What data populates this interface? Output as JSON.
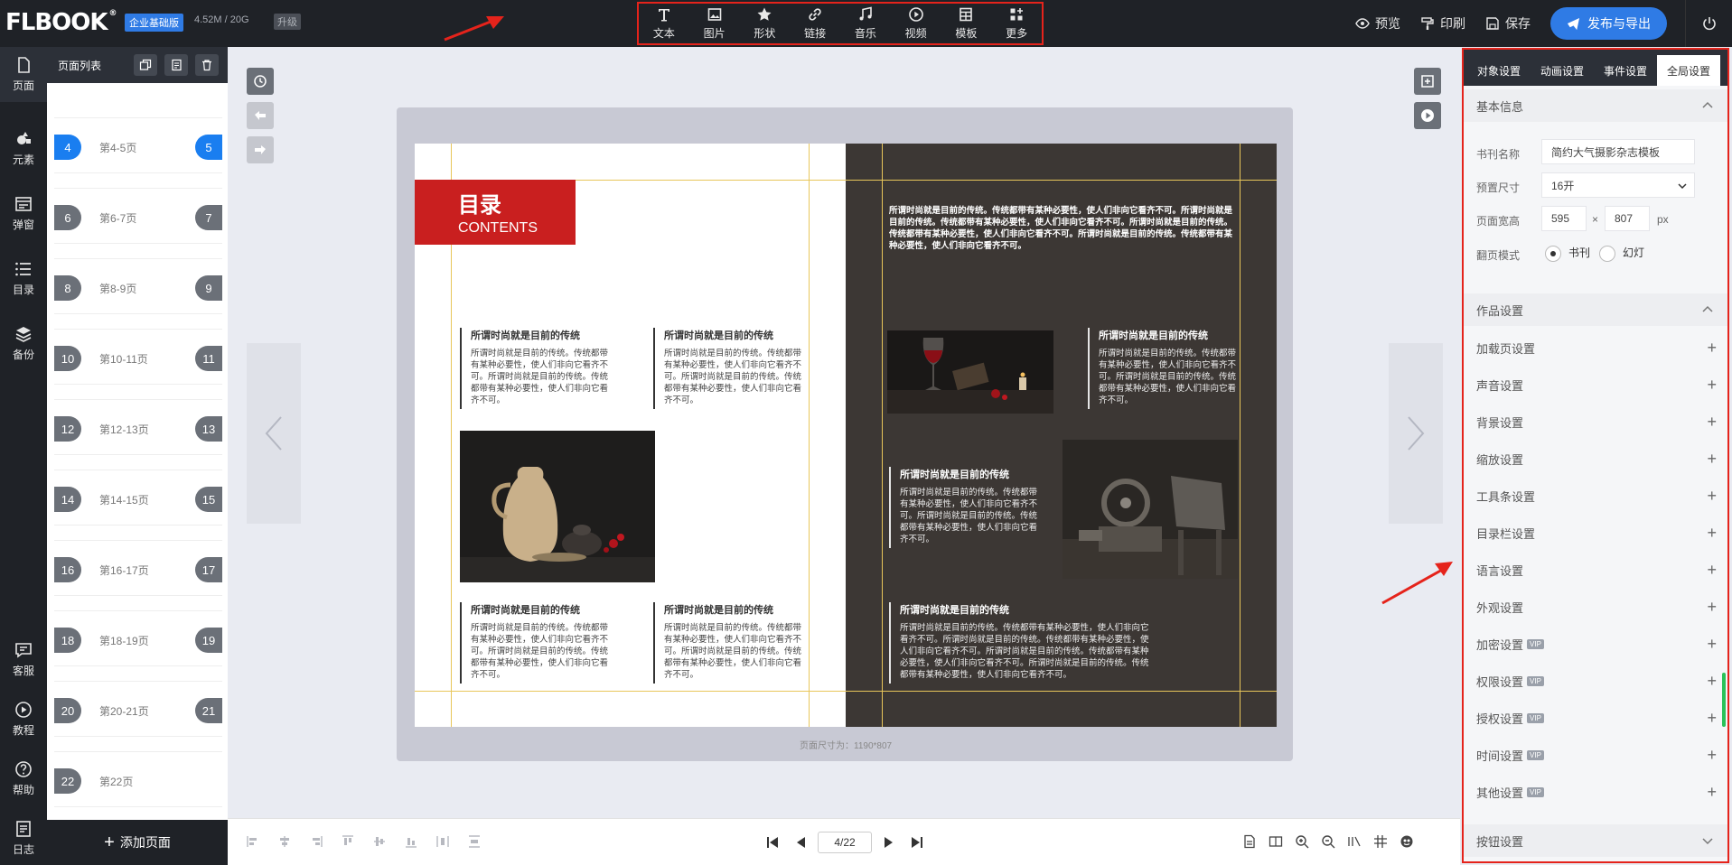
{
  "header": {
    "logo": "FLBOOK",
    "plan_badge": "企业基础版",
    "storage": "4.52M / 20G",
    "upgrade": "升级",
    "tools": [
      {
        "label": "文本",
        "icon": "text-icon"
      },
      {
        "label": "图片",
        "icon": "image-icon"
      },
      {
        "label": "形状",
        "icon": "star-icon"
      },
      {
        "label": "链接",
        "icon": "link-icon"
      },
      {
        "label": "音乐",
        "icon": "music-icon"
      },
      {
        "label": "视频",
        "icon": "video-icon"
      },
      {
        "label": "模板",
        "icon": "template-icon"
      },
      {
        "label": "更多",
        "icon": "more-icon"
      }
    ],
    "preview": "预览",
    "print": "印刷",
    "save": "保存",
    "publish": "发布与导出"
  },
  "sidebar": {
    "items": [
      {
        "label": "页面",
        "icon": "page-icon"
      },
      {
        "label": "元素",
        "icon": "elements-icon"
      },
      {
        "label": "弹窗",
        "icon": "popup-icon"
      },
      {
        "label": "目录",
        "icon": "list-icon"
      },
      {
        "label": "备份",
        "icon": "backup-icon"
      },
      {
        "label": "客服",
        "icon": "chat-icon"
      },
      {
        "label": "教程",
        "icon": "play-icon"
      },
      {
        "label": "帮助",
        "icon": "help-icon"
      },
      {
        "label": "日志",
        "icon": "log-icon"
      }
    ]
  },
  "pages_panel": {
    "title": "页面列表",
    "rows": [
      {
        "left": "4",
        "right": "5",
        "label": "第4-5页",
        "active": true
      },
      {
        "left": "6",
        "right": "7",
        "label": "第6-7页"
      },
      {
        "left": "8",
        "right": "9",
        "label": "第8-9页"
      },
      {
        "left": "10",
        "right": "11",
        "label": "第10-11页"
      },
      {
        "left": "12",
        "right": "13",
        "label": "第12-13页"
      },
      {
        "left": "14",
        "right": "15",
        "label": "第14-15页"
      },
      {
        "left": "16",
        "right": "17",
        "label": "第16-17页"
      },
      {
        "left": "18",
        "right": "19",
        "label": "第18-19页"
      },
      {
        "left": "20",
        "right": "21",
        "label": "第20-21页"
      },
      {
        "left": "22",
        "right": "",
        "label": "第22页"
      }
    ],
    "add_page": "添加页面"
  },
  "book": {
    "toc_title": "目录",
    "toc_sub": "CONTENTS",
    "article_title": "所谓时尚就是目前的传统",
    "article_body": "所谓时尚就是目前的传统。传统都带有某种必要性，使人们非向它看齐不可。所谓时尚就是目前的传统。传统都带有某种必要性，使人们非向它看齐不可。",
    "right_top": "所谓时尚就是目前的传统。传统都带有某种必要性，使人们非向它看齐不可。所谓时尚就是目前的传统。传统都带有某种必要性，使人们非向它看齐不可。所谓时尚就是目前的传统。传统都带有某种必要性，使人们非向它看齐不可。所谓时尚就是目前的传统。传统都带有某种必要性，使人们非向它看齐不可。",
    "long_body": "所谓时尚就是目前的传统。传统都带有某种必要性，使人们非向它看齐不可。所谓时尚就是目前的传统。传统都带有某种必要性，使人们非向它看齐不可。所谓时尚就是目前的传统。传统都带有某种必要性，使人们非向它看齐不可。所谓时尚就是目前的传统。传统都带有某种必要性，使人们非向它看齐不可。",
    "size_note": "页面尺寸为：1190*807"
  },
  "pager": {
    "value": "4/22"
  },
  "right_panel": {
    "tabs": [
      "对象设置",
      "动画设置",
      "事件设置",
      "全局设置"
    ],
    "basic_info": "基本信息",
    "book_name_label": "书刊名称",
    "book_name": "简约大气摄影杂志模板",
    "preset_size_label": "预置尺寸",
    "preset_size": "16开",
    "page_wh_label": "页面宽高",
    "width": "595",
    "times": "×",
    "height": "807",
    "unit": "px",
    "flip_label": "翻页模式",
    "flip_book": "书刊",
    "flip_slide": "幻灯",
    "work_settings": "作品设置",
    "items": [
      {
        "label": "加载页设置",
        "vip": false
      },
      {
        "label": "声音设置",
        "vip": false
      },
      {
        "label": "背景设置",
        "vip": false
      },
      {
        "label": "缩放设置",
        "vip": false
      },
      {
        "label": "工具条设置",
        "vip": false
      },
      {
        "label": "目录栏设置",
        "vip": false
      },
      {
        "label": "语言设置",
        "vip": false
      },
      {
        "label": "外观设置",
        "vip": false
      },
      {
        "label": "加密设置",
        "vip": true
      },
      {
        "label": "权限设置",
        "vip": true
      },
      {
        "label": "授权设置",
        "vip": true
      },
      {
        "label": "时间设置",
        "vip": true
      },
      {
        "label": "其他设置",
        "vip": true
      }
    ],
    "vip_badge": "VIP",
    "button_settings": "按钮设置"
  },
  "colors": {
    "accent": "#2f7be5",
    "highlight": "#e5231b",
    "dark": "#1f2227"
  }
}
